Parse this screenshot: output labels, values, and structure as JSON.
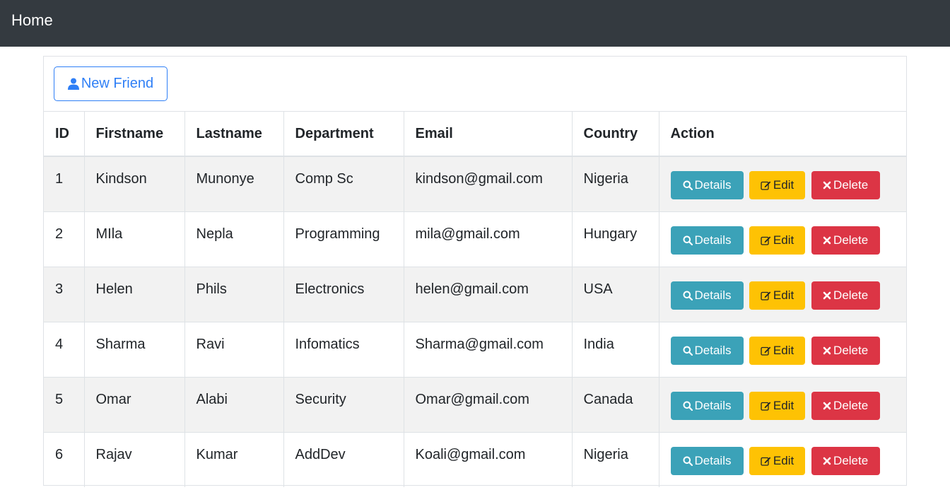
{
  "navbar": {
    "brand": "Home"
  },
  "toolbar": {
    "new_label": "New Friend"
  },
  "table": {
    "headers": [
      "ID",
      "Firstname",
      "Lastname",
      "Department",
      "Email",
      "Country",
      "Action"
    ],
    "rows": [
      {
        "id": "1",
        "firstname": "Kindson",
        "lastname": "Munonye",
        "department": "Comp Sc",
        "email": "kindson@gmail.com",
        "country": "Nigeria"
      },
      {
        "id": "2",
        "firstname": "MIla",
        "lastname": "Nepla",
        "department": "Programming",
        "email": "mila@gmail.com",
        "country": "Hungary"
      },
      {
        "id": "3",
        "firstname": "Helen",
        "lastname": "Phils",
        "department": "Electronics",
        "email": "helen@gmail.com",
        "country": "USA"
      },
      {
        "id": "4",
        "firstname": "Sharma",
        "lastname": "Ravi",
        "department": "Infomatics",
        "email": "Sharma@gmail.com",
        "country": "India"
      },
      {
        "id": "5",
        "firstname": "Omar",
        "lastname": "Alabi",
        "department": "Security",
        "email": "Omar@gmail.com",
        "country": "Canada"
      },
      {
        "id": "6",
        "firstname": "Rajav",
        "lastname": "Kumar",
        "department": "AddDev",
        "email": "Koali@gmail.com",
        "country": "Nigeria"
      }
    ],
    "actions": {
      "details": "Details",
      "edit": "Edit",
      "delete": "Delete"
    }
  },
  "icons": {
    "new": "user-icon",
    "details": "search-icon",
    "edit": "edit-icon",
    "delete": "close-icon"
  },
  "colors": {
    "navbar": "#343a40",
    "primary": "#2f7ff6",
    "info": "#3ba2b8",
    "warning": "#fec204",
    "danger": "#dc3545",
    "stripe": "#f2f2f2"
  }
}
